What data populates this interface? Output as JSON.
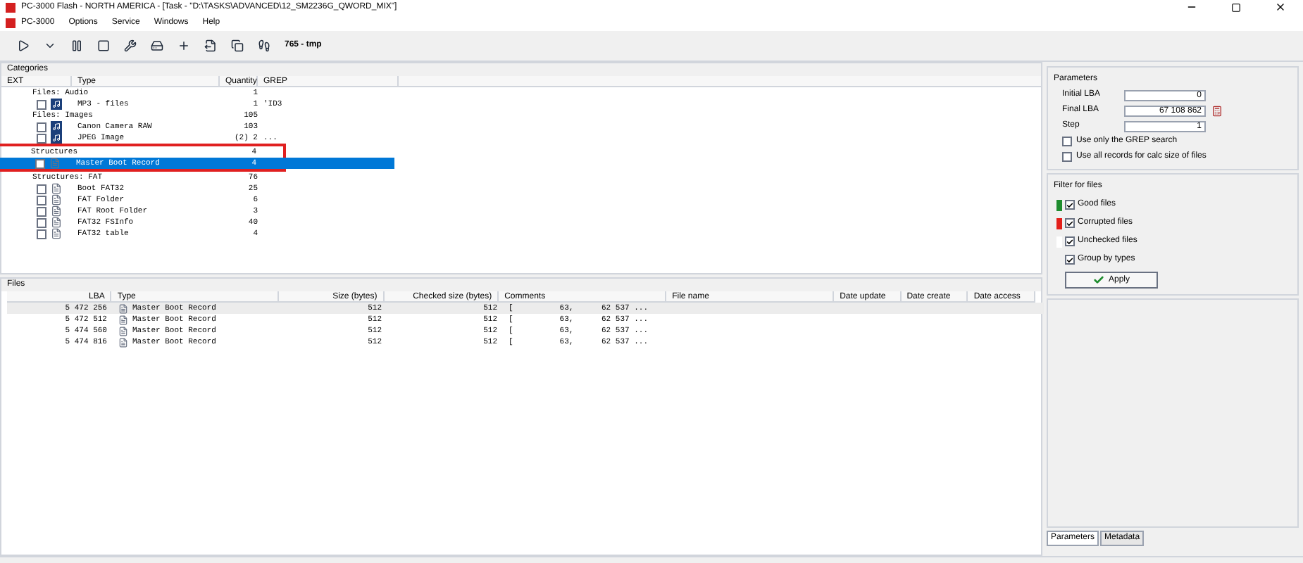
{
  "window": {
    "title": "PC-3000 Flash - NORTH AMERICA - [Task - \"D:\\TASKS\\ADVANCED\\12_SM2236G_QWORD_MIX\"]"
  },
  "menu": [
    {
      "label": "PC-3000"
    },
    {
      "label": "Options"
    },
    {
      "label": "Service"
    },
    {
      "label": "Windows"
    },
    {
      "label": "Help"
    }
  ],
  "toolbar": {
    "task_label": "765 - tmp"
  },
  "categories": {
    "title": "Categories",
    "columns": [
      "EXT",
      "Type",
      "Quantity",
      "GREP"
    ],
    "groups": [
      {
        "name": "Files: Audio",
        "quantity": "1",
        "highlighted": false,
        "children": [
          {
            "type": "MP3 - files",
            "quantity": "1",
            "grep": "'ID3",
            "checked": false,
            "selected": false,
            "kind": "media"
          }
        ]
      },
      {
        "name": "Files: Images",
        "quantity": "105",
        "highlighted": false,
        "children": [
          {
            "type": "Canon Camera RAW",
            "quantity": "103",
            "checked": false,
            "selected": false,
            "kind": "media"
          },
          {
            "type": "JPEG Image",
            "quantity": "(2) 2",
            "grep": "...",
            "checked": false,
            "selected": false,
            "kind": "media"
          }
        ]
      },
      {
        "name": "Structures",
        "quantity": "4",
        "highlighted": true,
        "children": [
          {
            "type": "Master Boot Record",
            "quantity": "4",
            "checked": false,
            "selected": true,
            "kind": "doc"
          }
        ]
      },
      {
        "name": "Structures: FAT",
        "quantity": "76",
        "highlighted": false,
        "children": [
          {
            "type": "Boot FAT32",
            "quantity": "25",
            "checked": false,
            "selected": false,
            "kind": "doc"
          },
          {
            "type": "FAT Folder",
            "quantity": "6",
            "checked": false,
            "selected": false,
            "kind": "doc"
          },
          {
            "type": "FAT Root Folder",
            "quantity": "3",
            "checked": false,
            "selected": false,
            "kind": "doc"
          },
          {
            "type": "FAT32 FSInfo",
            "quantity": "40",
            "checked": false,
            "selected": false,
            "kind": "doc"
          },
          {
            "type": "FAT32 table",
            "quantity": "4",
            "checked": false,
            "selected": false,
            "kind": "doc"
          }
        ]
      }
    ]
  },
  "files": {
    "title": "Files",
    "columns": [
      "LBA",
      "Type",
      "Size (bytes)",
      "Checked size (bytes)",
      "Comments",
      "File name",
      "Date update",
      "Date create",
      "Date access"
    ],
    "rows": [
      {
        "lba": "5 472 256",
        "type": "Master Boot Record",
        "size": "512",
        "checked_size": "512",
        "comments": "[          63,      62 537 ...",
        "selected": true
      },
      {
        "lba": "5 472 512",
        "type": "Master Boot Record",
        "size": "512",
        "checked_size": "512",
        "comments": "[          63,      62 537 ...",
        "selected": false
      },
      {
        "lba": "5 474 560",
        "type": "Master Boot Record",
        "size": "512",
        "checked_size": "512",
        "comments": "[          63,      62 537 ...",
        "selected": false
      },
      {
        "lba": "5 474 816",
        "type": "Master Boot Record",
        "size": "512",
        "checked_size": "512",
        "comments": "[          63,      62 537 ...",
        "selected": false
      }
    ]
  },
  "parameters": {
    "title": "Parameters",
    "fields": [
      {
        "label": "Initial LBA",
        "value": "0"
      },
      {
        "label": "Final LBA",
        "value": "67 108 862"
      },
      {
        "label": "Step",
        "value": "1"
      }
    ],
    "options": [
      {
        "label": "Use only the GREP search",
        "checked": false
      },
      {
        "label": "Use all records for calc size of files",
        "checked": false
      }
    ]
  },
  "filter": {
    "title": "Filter for files",
    "items": [
      {
        "label": "Good files",
        "checked": true,
        "color": "#1e8c2e"
      },
      {
        "label": "Corrupted files",
        "checked": true,
        "color": "#e3201b"
      },
      {
        "label": "Unchecked files",
        "checked": true,
        "color": "#ffffff"
      }
    ],
    "group_by_types": {
      "label": "Group by types",
      "checked": true
    },
    "apply_button": "Apply"
  },
  "panel_tabs": [
    {
      "label": "Parameters",
      "selected": true
    },
    {
      "label": "Metadata",
      "selected": false
    }
  ]
}
